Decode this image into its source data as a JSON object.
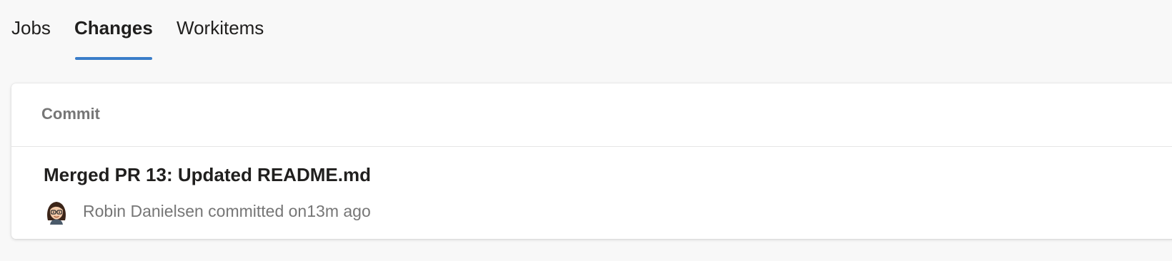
{
  "tabs": [
    {
      "label": "Jobs",
      "selected": false
    },
    {
      "label": "Changes",
      "selected": true
    },
    {
      "label": "Workitems",
      "selected": false
    }
  ],
  "accent_color": "#3a7dc9",
  "commits_table": {
    "column_header": "Commit",
    "rows": [
      {
        "title": "Merged PR 13: Updated README.md",
        "author": "Robin Danielsen",
        "action": "committed on",
        "time": "13m ago",
        "avatar_icon": "avatar-emoji-icon"
      }
    ]
  }
}
